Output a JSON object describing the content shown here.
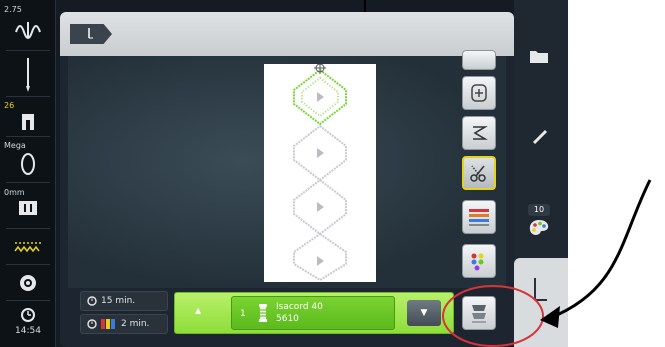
{
  "left_bar": {
    "speed_value": "2.75",
    "stitch_length": "26",
    "presser_foot": "Mega",
    "needle_position": "0mm",
    "clock": "14:54"
  },
  "bottom": {
    "total_time": "15 min.",
    "color_time": "2 min.",
    "thread": {
      "number": "1",
      "name": "Isacord 40",
      "code": "5610"
    }
  },
  "right_panel": {
    "badge": "10"
  },
  "colors": {
    "accent_yellow": "#e6d21a",
    "thread_green": "#6cc624",
    "annotation_red": "#d8323a"
  },
  "icons": [
    "folder-icon",
    "pencil-icon",
    "palette-icon",
    "scissors-icon",
    "hoop-center-icon",
    "clock-icon",
    "thread-spool-icon",
    "chevron-down-icon",
    "chevron-up-icon"
  ]
}
